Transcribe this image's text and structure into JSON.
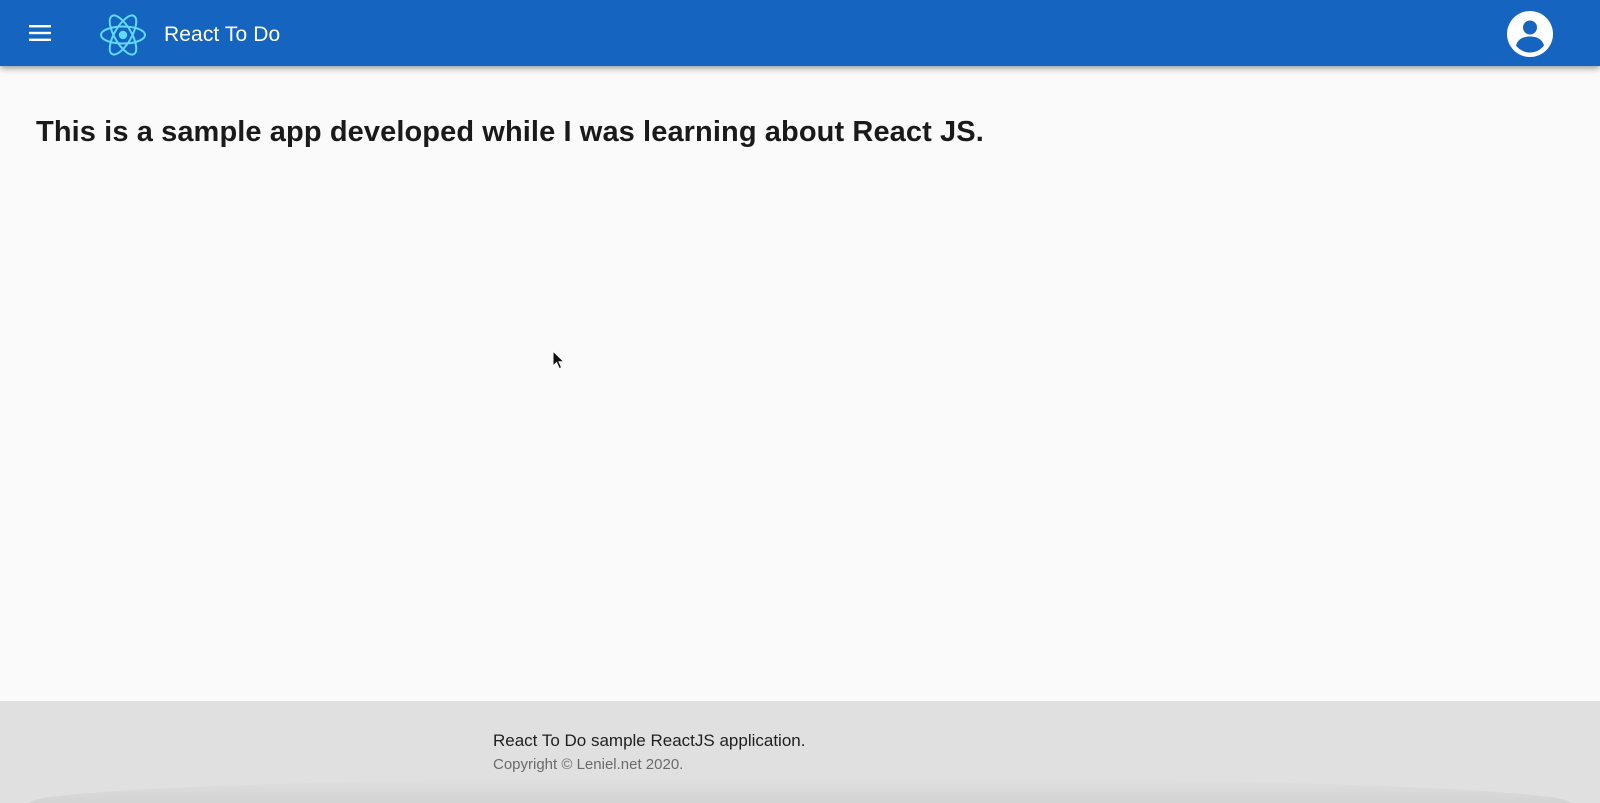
{
  "appbar": {
    "menu_icon": "menu-icon",
    "logo_icon": "react-logo-icon",
    "title": "React To Do",
    "account_icon": "account-circle-icon",
    "background_color": "#1565c0",
    "logo_color": "#61dafb"
  },
  "main": {
    "headline": "This is a sample app developed while I was learning about React JS."
  },
  "footer": {
    "text": "React To Do sample ReactJS application.",
    "copyright": "Copyright © Leniel.net 2020.",
    "background_color": "#e0e0e0"
  }
}
